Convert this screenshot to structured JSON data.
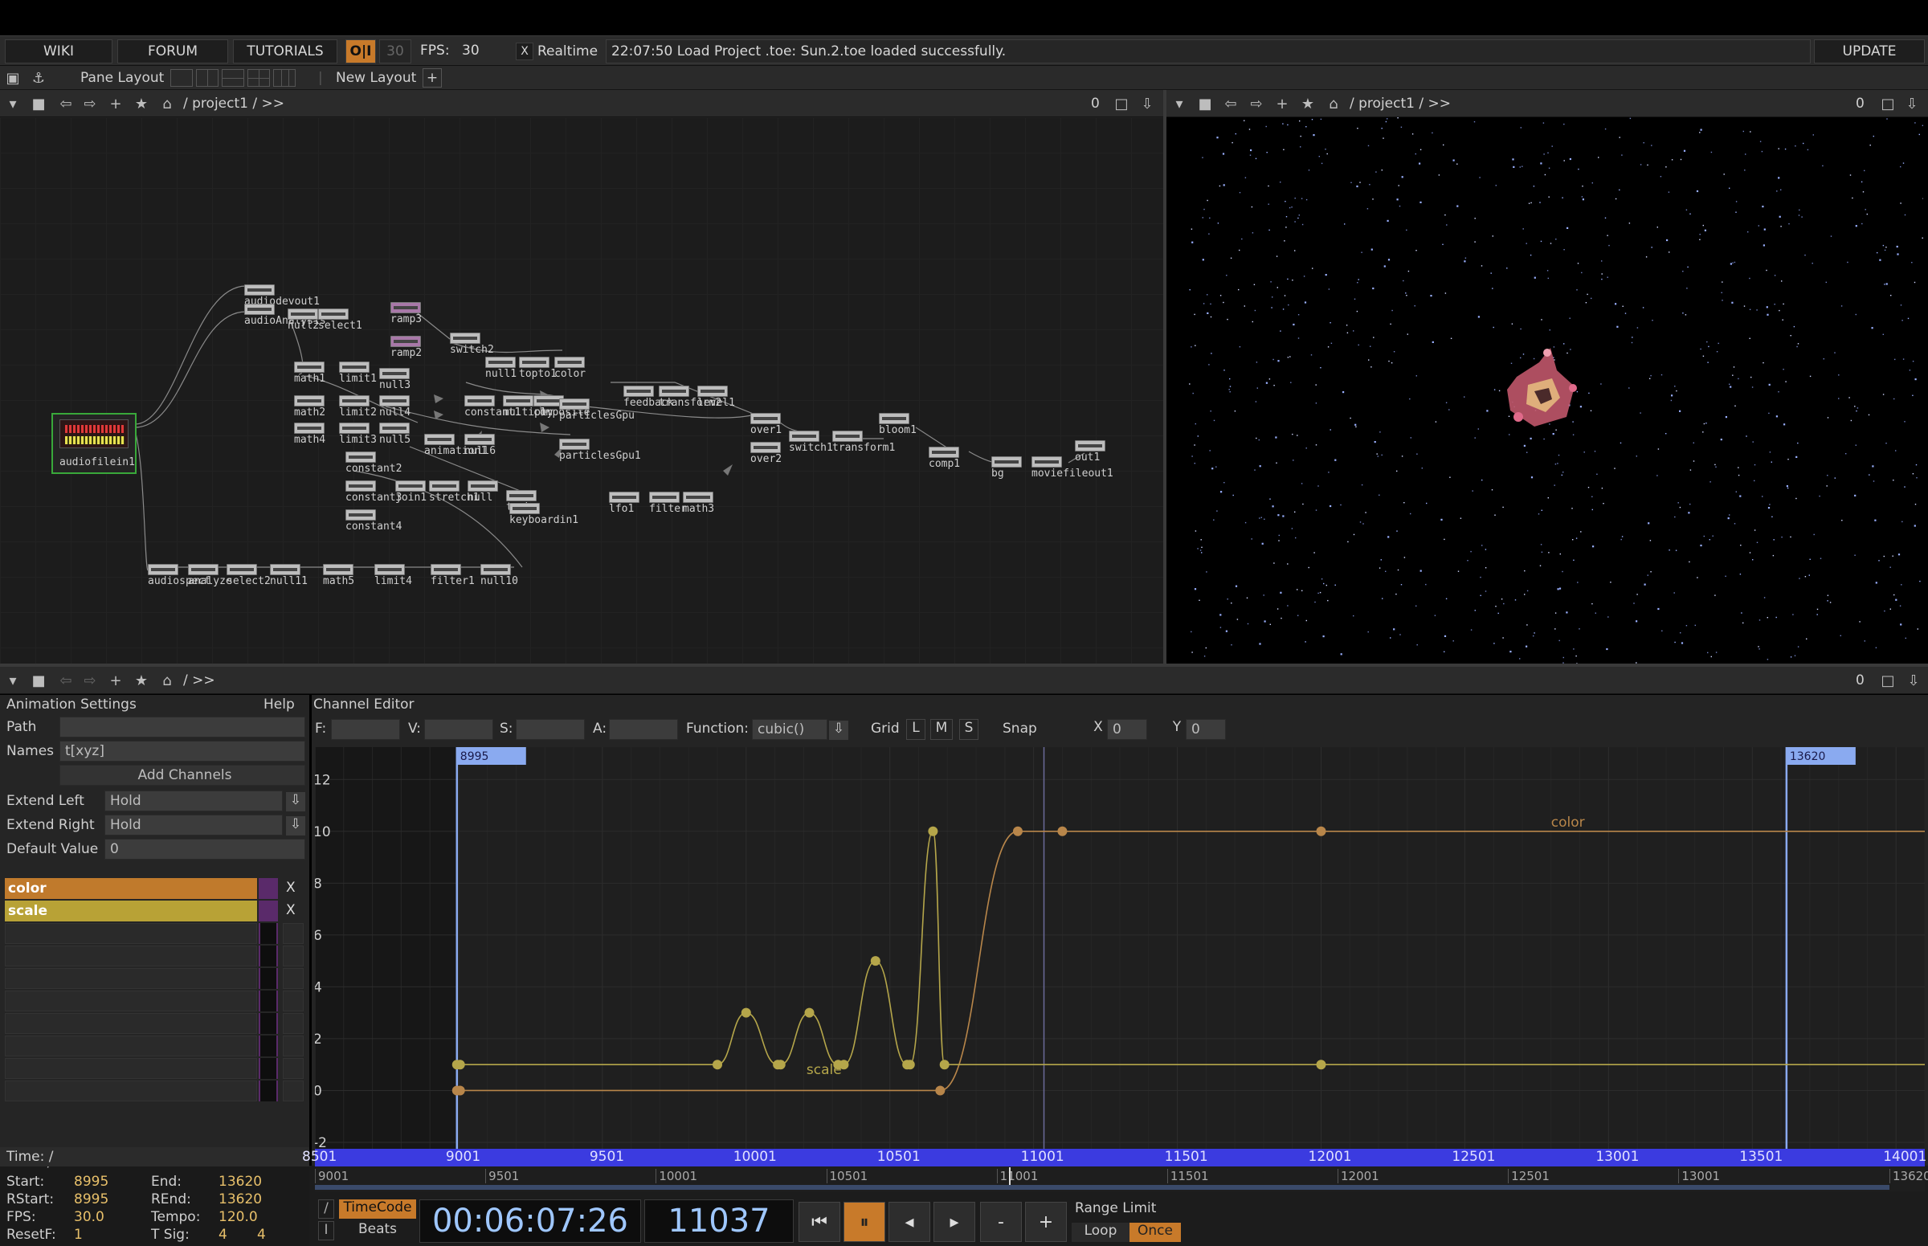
{
  "menubar": {
    "wiki": "WIKI",
    "forum": "FORUM",
    "tutorials": "TUTORIALS",
    "oi": "O|I",
    "fps_dim": "30",
    "fps_label": "FPS:",
    "fps_value": "30",
    "realtime_check": "X",
    "realtime": "Realtime",
    "status": "22:07:50 Load Project .toe: Sun.2.toe loaded successfully.",
    "update": "UPDATE"
  },
  "layoutbar": {
    "pane_layout": "Pane Layout",
    "new_layout": "New Layout",
    "plus": "+"
  },
  "netpane": {
    "path": "/ project1 / >>",
    "counter": "0"
  },
  "viewerpane": {
    "path": "/ project1 / >>",
    "counter": "0"
  },
  "bottompane": {
    "path": "/ >>",
    "counter": "0"
  },
  "nodes": [
    "audiodevout1",
    "audioAnalysis",
    "null2",
    "select1",
    "ramp3",
    "ramp2",
    "switch2",
    "null1",
    "topto1",
    "color",
    "math1",
    "limit1",
    "null3",
    "feedback",
    "transform2",
    "level1",
    "math2",
    "limit2",
    "null4",
    "constant1",
    "multiply",
    "composite",
    "particlesGpu",
    "over1",
    "bloom1",
    "math4",
    "limit3",
    "null5",
    "animation1",
    "null6",
    "particlesGpu1",
    "over2",
    "switch1",
    "transform1",
    "comp1",
    "bg",
    "moviefileout1",
    "out1",
    "constant2",
    "constant3",
    "join1",
    "stretch1",
    "null",
    "turb",
    "keyboardin1",
    "lfo1",
    "filter",
    "math3",
    "constant4",
    "audiofilein1",
    "audiospect",
    "analyze",
    "select2",
    "null11",
    "math5",
    "limit4",
    "filter1",
    "null10"
  ],
  "anim": {
    "title": "Animation Settings",
    "help": "Help",
    "path_label": "Path",
    "path_value": "",
    "names_label": "Names",
    "names_value": "t[xyz]",
    "add_channels": "Add Channels",
    "extend_left_label": "Extend Left",
    "extend_left": "Hold",
    "extend_right_label": "Extend Right",
    "extend_right": "Hold",
    "default_label": "Default Value",
    "default_value": "0",
    "ch1": "color",
    "ch2": "scale",
    "x": "X"
  },
  "chedit": {
    "title": "Channel Editor",
    "f": "F:",
    "v": "V:",
    "s": "S:",
    "a": "A:",
    "function_label": "Function:",
    "function": "cubic()",
    "grid": "Grid",
    "l": "L",
    "m": "M",
    "sz": "S",
    "snap": "Snap",
    "snapx": "X",
    "snapx_val": "0",
    "snapy": "Y",
    "snapy_val": "0",
    "range_start_label": "8995",
    "range_end_label": "13620",
    "color_label": "color",
    "scale_label": "scale"
  },
  "chart_data": {
    "type": "line",
    "x_range": [
      8501,
      14101
    ],
    "ylim": [
      -2,
      13
    ],
    "y_ticks": [
      "12",
      "10",
      "8",
      "6",
      "4",
      "2",
      "0",
      "-2"
    ],
    "x_ticks_top": [
      "8501",
      "9001",
      "9501",
      "10001",
      "10501",
      "11001",
      "11501",
      "12001",
      "12501",
      "13001",
      "13501",
      "14001"
    ],
    "x_ticks_bottom": [
      "9001",
      "9501",
      "10001",
      "10501",
      "11001",
      "11501",
      "12001",
      "12501",
      "13001",
      "13620"
    ],
    "x_ticks_bottom_vals": [
      9001,
      9501,
      10001,
      10501,
      11001,
      11501,
      12001,
      12501,
      13001,
      13620
    ],
    "series": [
      {
        "name": "color",
        "color": "#b8864a",
        "points": [
          [
            8995,
            0
          ],
          [
            9006,
            0
          ],
          [
            10676,
            0
          ],
          [
            10946,
            10
          ],
          [
            11101,
            10
          ],
          [
            12001,
            10
          ],
          [
            14101,
            10
          ]
        ]
      },
      {
        "name": "scale",
        "color": "#b5a64a",
        "points": [
          [
            8995,
            1
          ],
          [
            9006,
            1
          ],
          [
            9901,
            1
          ],
          [
            10001,
            3
          ],
          [
            10111,
            1
          ],
          [
            10121,
            1
          ],
          [
            10221,
            3
          ],
          [
            10321,
            1
          ],
          [
            10341,
            1
          ],
          [
            10451,
            5
          ],
          [
            10561,
            1
          ],
          [
            10571,
            1
          ],
          [
            10651,
            10
          ],
          [
            10691,
            1
          ],
          [
            12001,
            1
          ],
          [
            14101,
            1
          ]
        ]
      }
    ],
    "range": [
      8995,
      13620
    ],
    "current": 11037
  },
  "time": {
    "header": "Time: /",
    "start_label": "Start:",
    "start": "8995",
    "end_label": "End:",
    "end": "13620",
    "rstart_label": "RStart:",
    "rstart": "8995",
    "rend_label": "REnd:",
    "rend": "13620",
    "fps_label": "FPS:",
    "fps": "30.0",
    "tempo_label": "Tempo:",
    "tempo": "120.0",
    "resetf_label": "ResetF:",
    "resetf": "1",
    "tsig_label": "T Sig:",
    "tsig1": "4",
    "tsig2": "4"
  },
  "transport": {
    "timecode": "TimeCode",
    "beats": "Beats",
    "timecode_value": "00:06:07:26",
    "frame": "11037",
    "range_limit": "Range Limit",
    "loop": "Loop",
    "once": "Once",
    "minus": "-",
    "plus": "+"
  }
}
